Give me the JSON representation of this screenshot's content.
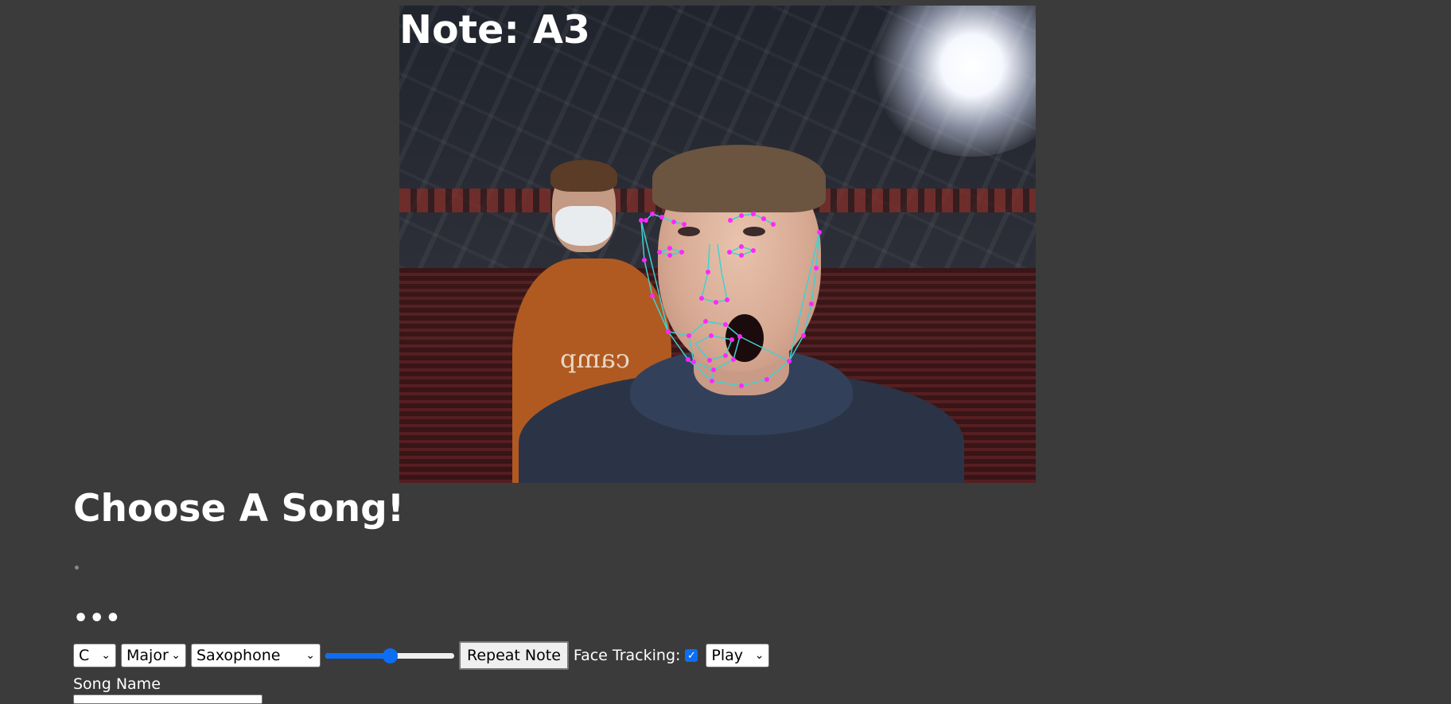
{
  "webcam": {
    "note_label": "Note: A3",
    "shirt_text": "camp"
  },
  "page": {
    "title": "Choose A Song!",
    "dots": "•••"
  },
  "controls": {
    "key": {
      "value": "C"
    },
    "scale": {
      "value": "Major"
    },
    "instrument": {
      "value": "Saxophone"
    },
    "volume": {
      "value": 0.5
    },
    "repeat_note_label": "Repeat Note",
    "face_tracking_label": "Face Tracking:",
    "face_tracking_checked": true,
    "mode": {
      "value": "Play"
    }
  },
  "song": {
    "name_label": "Song Name",
    "name_value": ""
  },
  "colors": {
    "background": "#3b3b3b",
    "accent": "#0d6ef3",
    "mesh_line": "#41d1d1",
    "mesh_point": "#ff27ff"
  }
}
